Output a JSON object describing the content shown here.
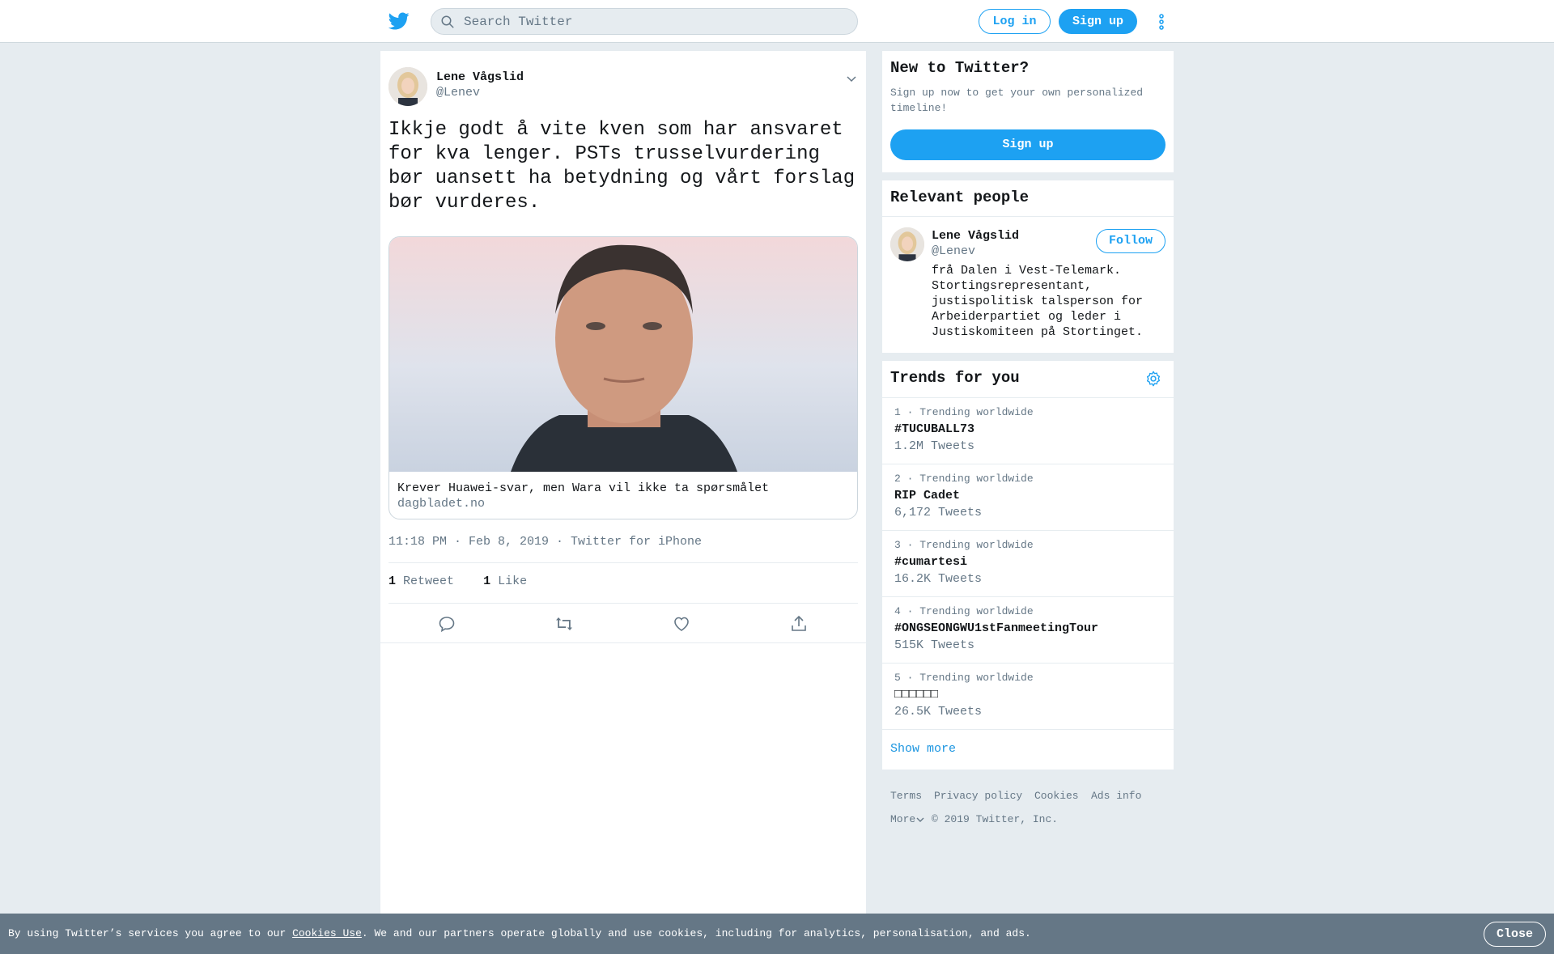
{
  "header": {
    "search_placeholder": "Search Twitter",
    "login_label": "Log in",
    "signup_label": "Sign up",
    "logo_icon": "twitter-bird-icon",
    "more_icon": "more-vertical-icon"
  },
  "tweet": {
    "author_name": "Lene Vågslid",
    "author_handle": "@Lenev",
    "text": "Ikkje godt å vite kven som har ansvaret for kva lenger. PSTs trusselvurdering bør uansett ha betydning og vårt forslag bør vurderes.",
    "card_title": "Krever Huawei-svar, men Wara vil ikke ta spørsmålet",
    "card_domain": "dagbladet.no",
    "timestamp": "11:18 PM · Feb 8, 2019 · Twitter for iPhone",
    "retweets_count": "1",
    "retweets_label": "Retweet",
    "likes_count": "1",
    "likes_label": "Like",
    "actions": [
      "reply-icon",
      "retweet-icon",
      "like-icon",
      "share-icon"
    ]
  },
  "new_to_twitter": {
    "title": "New to Twitter?",
    "subtitle": "Sign up now to get your own personalized timeline!",
    "signup_label": "Sign up"
  },
  "relevant_people": {
    "title": "Relevant people",
    "name": "Lene Vågslid",
    "handle": "@Lenev",
    "follow_label": "Follow",
    "bio": "frå Dalen i Vest-Telemark. Stortingsrepresentant, justispolitisk talsperson for Arbeiderpartiet og leder i Justiskomiteen på Stortinget."
  },
  "trends": {
    "title": "Trends for you",
    "items": [
      {
        "meta": "1 · Trending worldwide",
        "name": "#TUCUBALL73",
        "count": "1.2M Tweets"
      },
      {
        "meta": "2 · Trending worldwide",
        "name": "RIP Cadet",
        "count": "6,172 Tweets"
      },
      {
        "meta": "3 · Trending worldwide",
        "name": "#cumartesi",
        "count": "16.2K Tweets"
      },
      {
        "meta": "4 · Trending worldwide",
        "name": "#ONGSEONGWU1stFanmeetingTour",
        "count": "515K Tweets"
      },
      {
        "meta": "5 · Trending worldwide",
        "name": "□□□□□□",
        "count": "26.5K Tweets"
      }
    ],
    "show_more": "Show more"
  },
  "footer": {
    "terms": "Terms",
    "privacy": "Privacy policy",
    "cookies": "Cookies",
    "ads_info": "Ads info",
    "more": "More",
    "copyright": "© 2019 Twitter, Inc."
  },
  "cookie_bar": {
    "text_before": "By using Twitter’s services you agree to our ",
    "link": "Cookies Use",
    "text_after": ". We and our partners operate globally and use cookies, including for analytics, personalisation, and ads.",
    "close_label": "Close"
  },
  "colors": {
    "accent": "#1da1f2",
    "background": "#e6ecf0",
    "secondary_text": "#657786",
    "cookie_bar": "#657786"
  }
}
